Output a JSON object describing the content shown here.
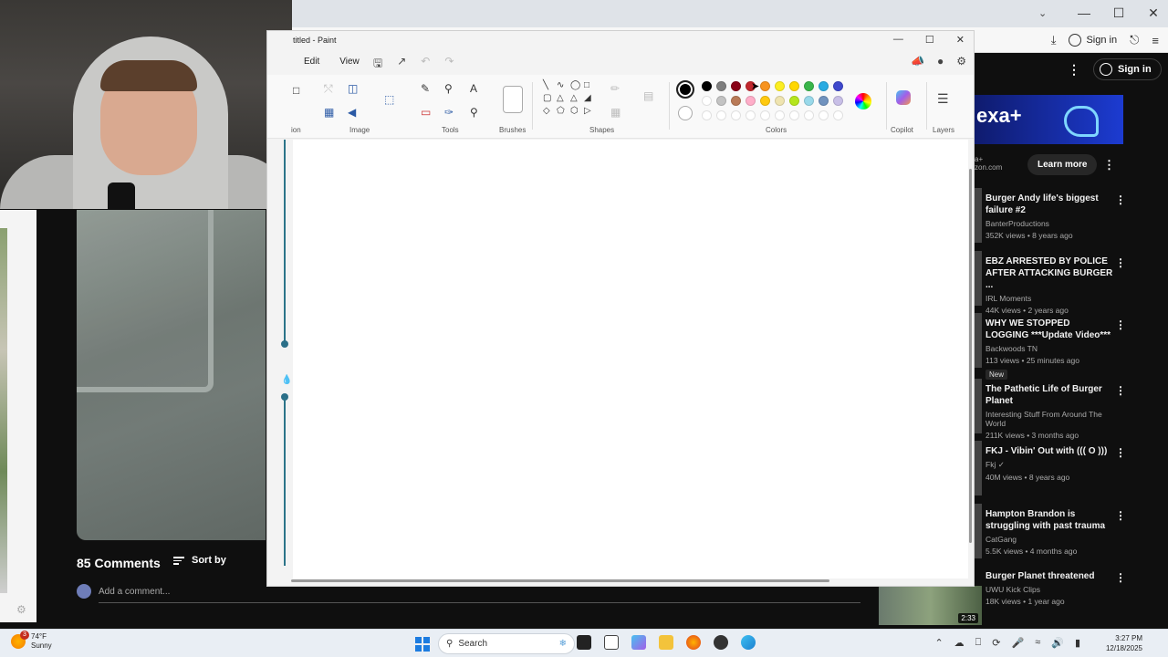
{
  "paint": {
    "title": "titled - Paint",
    "menu": {
      "edit": "Edit",
      "view": "View"
    },
    "ribbon_labels": {
      "selection": "ion",
      "image": "Image",
      "tools": "Tools",
      "brushes": "Brushes",
      "shapes": "Shapes",
      "colors": "Colors",
      "copilot": "Copilot",
      "layers": "Layers"
    },
    "palette_row1": [
      "#000000",
      "#7f7f7f",
      "#880015",
      "#c1272d",
      "#f7931e",
      "#fcee21",
      "#ffd700",
      "#39b54a",
      "#29abe2",
      "#3f48cc",
      "#a349a4"
    ],
    "palette_row2": [
      "#ffffff",
      "#c3c3c3",
      "#b97a57",
      "#ffaec9",
      "#ffc90e",
      "#efe4b0",
      "#b5e61d",
      "#99d9ea",
      "#7092be",
      "#c8bfe7"
    ]
  },
  "browser": {
    "signin_label": "Sign in"
  },
  "youtube": {
    "signin_label": "Sign in",
    "ad": {
      "brand_text": "exa+",
      "meta_line1": "a+",
      "meta_line2": "zon.com",
      "learn_more": "Learn more"
    },
    "comments_count": "85 Comments",
    "sort_by": "Sort by",
    "add_comment_placeholder": "Add a comment...",
    "recommendations": [
      {
        "title": "Burger Andy life's biggest failure #2",
        "channel": "BanterProductions",
        "meta": "352K views • 8 years ago"
      },
      {
        "title": "EBZ ARRESTED BY POLICE AFTER ATTACKING BURGER ...",
        "channel": "IRL Moments",
        "meta": "44K views • 2 years ago"
      },
      {
        "title": "WHY WE STOPPED LOGGING ***Update Video***",
        "channel": "Backwoods TN",
        "meta": "113 views • 25 minutes ago",
        "badge": "New"
      },
      {
        "title": "The Pathetic Life of Burger Planet",
        "channel": "Interesting Stuff From Around The World",
        "meta": "211K views • 3 months ago"
      },
      {
        "title": "FKJ - Vibin' Out with ((( O )))",
        "channel": "Fkj ✓",
        "meta": "40M views • 8 years ago"
      },
      {
        "title": "Hampton Brandon is struggling with past trauma",
        "channel": "CatGang",
        "meta": "5.5K views • 4 months ago"
      },
      {
        "title": "Burger Planet threatened",
        "channel": "UWU Kick Clips",
        "meta": "18K views • 1 year ago"
      }
    ],
    "thumb_duration": "2:33"
  },
  "taskbar": {
    "weather_temp": "74°F",
    "weather_desc": "Sunny",
    "weather_badge": "3",
    "search_label": "Search",
    "time": "3:27 PM",
    "date": "12/18/2025"
  }
}
